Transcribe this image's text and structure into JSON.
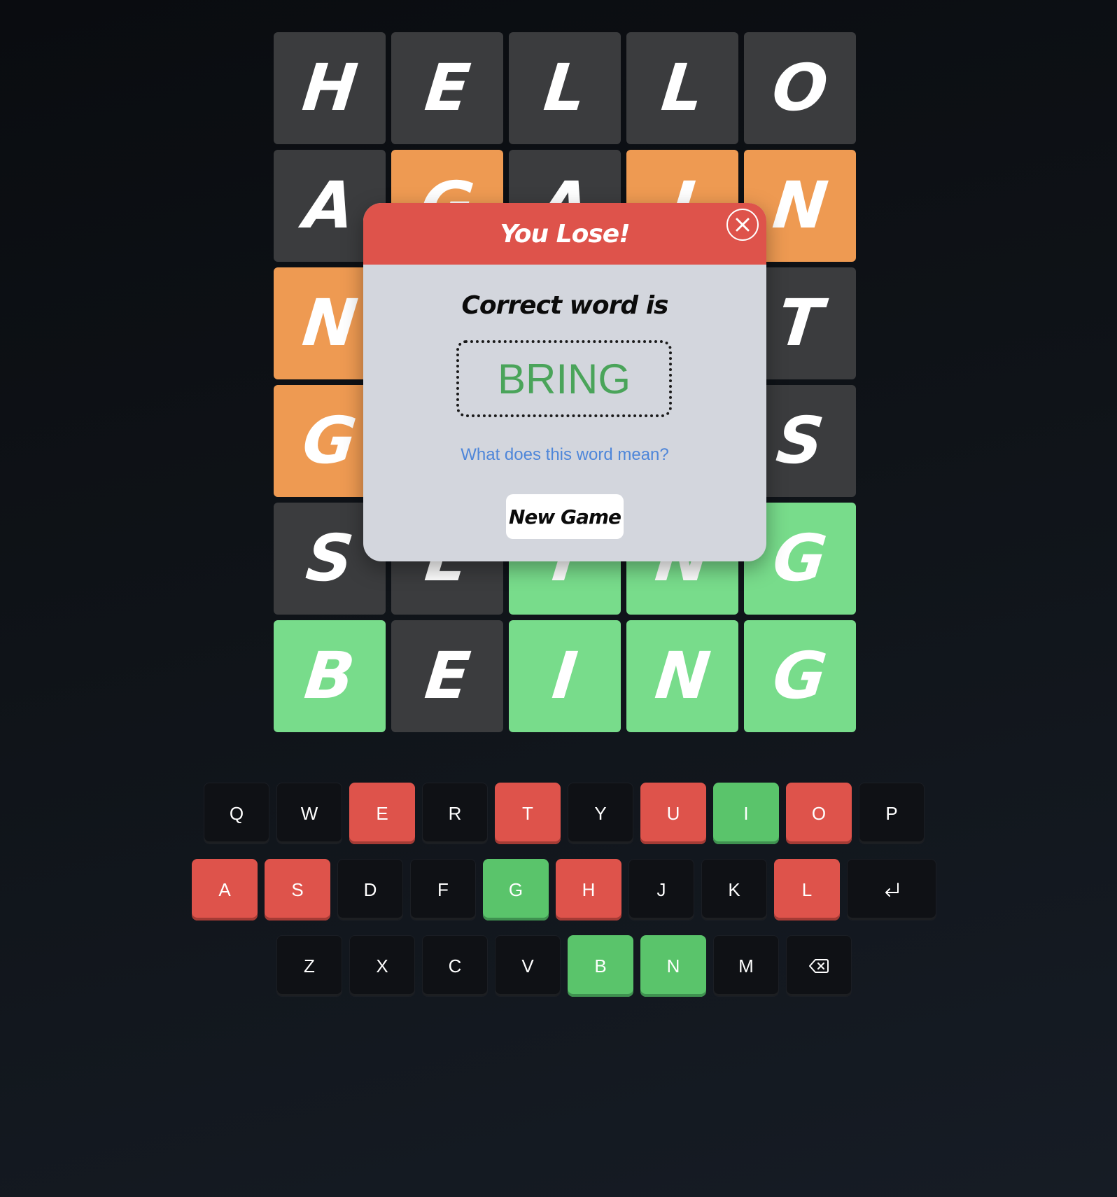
{
  "board": {
    "rows": [
      [
        {
          "letter": "H",
          "state": "absent"
        },
        {
          "letter": "E",
          "state": "absent"
        },
        {
          "letter": "L",
          "state": "absent"
        },
        {
          "letter": "L",
          "state": "absent"
        },
        {
          "letter": "O",
          "state": "absent"
        }
      ],
      [
        {
          "letter": "A",
          "state": "absent"
        },
        {
          "letter": "G",
          "state": "present"
        },
        {
          "letter": "A",
          "state": "absent"
        },
        {
          "letter": "I",
          "state": "present"
        },
        {
          "letter": "N",
          "state": "present"
        }
      ],
      [
        {
          "letter": "N",
          "state": "present"
        },
        {
          "letter": "",
          "state": "absent"
        },
        {
          "letter": "",
          "state": "absent"
        },
        {
          "letter": "",
          "state": "absent"
        },
        {
          "letter": "T",
          "state": "absent"
        }
      ],
      [
        {
          "letter": "G",
          "state": "present"
        },
        {
          "letter": "",
          "state": "absent"
        },
        {
          "letter": "",
          "state": "absent"
        },
        {
          "letter": "",
          "state": "absent"
        },
        {
          "letter": "S",
          "state": "absent"
        }
      ],
      [
        {
          "letter": "S",
          "state": "absent"
        },
        {
          "letter": "E",
          "state": "absent"
        },
        {
          "letter": "I",
          "state": "correct"
        },
        {
          "letter": "N",
          "state": "correct"
        },
        {
          "letter": "G",
          "state": "correct"
        }
      ],
      [
        {
          "letter": "B",
          "state": "correct"
        },
        {
          "letter": "E",
          "state": "absent"
        },
        {
          "letter": "I",
          "state": "correct"
        },
        {
          "letter": "N",
          "state": "correct"
        },
        {
          "letter": "G",
          "state": "correct"
        }
      ]
    ]
  },
  "keyboard": {
    "rows": [
      [
        {
          "label": "Q",
          "state": "default"
        },
        {
          "label": "W",
          "state": "default"
        },
        {
          "label": "E",
          "state": "absent"
        },
        {
          "label": "R",
          "state": "default"
        },
        {
          "label": "T",
          "state": "absent"
        },
        {
          "label": "Y",
          "state": "default"
        },
        {
          "label": "U",
          "state": "absent"
        },
        {
          "label": "I",
          "state": "correct"
        },
        {
          "label": "O",
          "state": "absent"
        },
        {
          "label": "P",
          "state": "default"
        }
      ],
      [
        {
          "label": "A",
          "state": "absent"
        },
        {
          "label": "S",
          "state": "absent"
        },
        {
          "label": "D",
          "state": "default"
        },
        {
          "label": "F",
          "state": "default"
        },
        {
          "label": "G",
          "state": "correct"
        },
        {
          "label": "H",
          "state": "absent"
        },
        {
          "label": "J",
          "state": "default"
        },
        {
          "label": "K",
          "state": "default"
        },
        {
          "label": "L",
          "state": "absent"
        },
        {
          "label": "",
          "state": "default",
          "icon": "enter-icon"
        }
      ],
      [
        {
          "label": "Z",
          "state": "default"
        },
        {
          "label": "X",
          "state": "default"
        },
        {
          "label": "C",
          "state": "default"
        },
        {
          "label": "V",
          "state": "default"
        },
        {
          "label": "B",
          "state": "correct"
        },
        {
          "label": "N",
          "state": "correct"
        },
        {
          "label": "M",
          "state": "default"
        },
        {
          "label": "",
          "state": "default",
          "icon": "backspace-icon"
        }
      ]
    ]
  },
  "modal": {
    "title": "You Lose!",
    "subtitle": "Correct word is",
    "answer": "BRING",
    "meaning_link": "What does this word mean?",
    "new_game_label": "New Game",
    "close_icon": "close-icon"
  },
  "colors": {
    "tile_absent": "#3b3c3e",
    "tile_present": "#ee9a52",
    "tile_correct": "#78dc8b",
    "key_absent": "#de534b",
    "key_correct": "#5ac46b",
    "modal_header": "#de534b",
    "answer_text": "#4aa45a",
    "link": "#4e86d9"
  }
}
